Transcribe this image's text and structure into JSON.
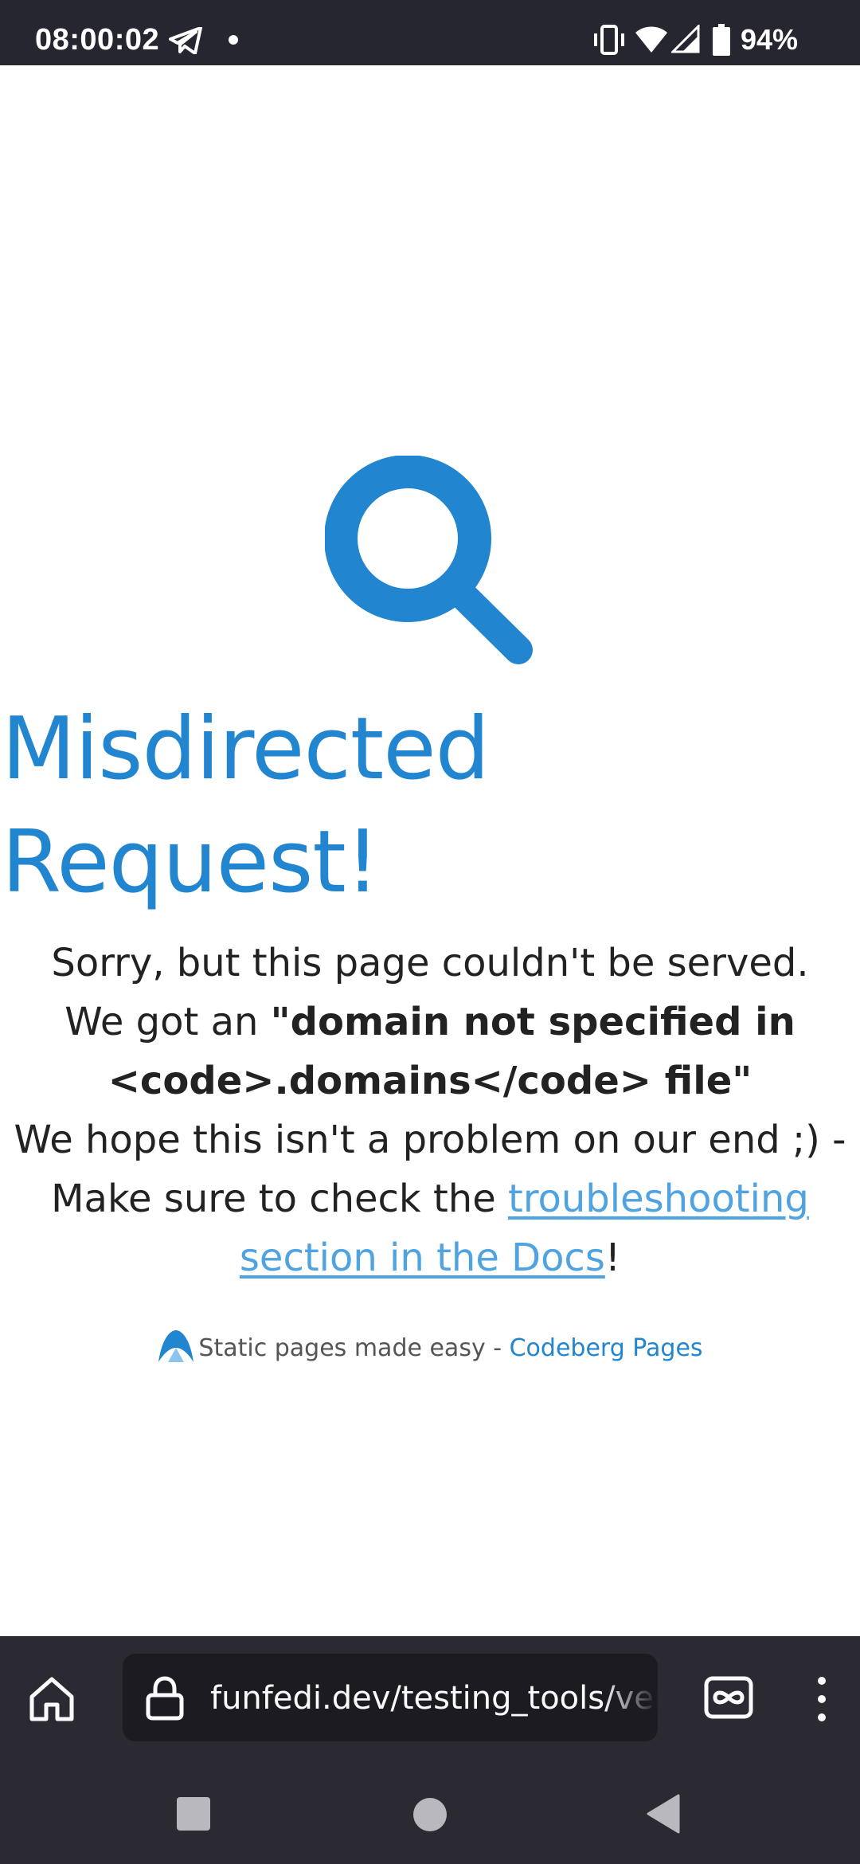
{
  "status_bar": {
    "time": "08:00:02",
    "battery": "94%",
    "icons": [
      "telegram-icon",
      "notification-dot",
      "vibrate-icon",
      "wifi-icon",
      "signal-icon",
      "battery-icon"
    ]
  },
  "page": {
    "icon": "magnifier-icon",
    "heading": "Misdirected Request!",
    "message": {
      "line1": "Sorry, but this page couldn't be served.",
      "line2_prefix": "We got an ",
      "error": "\"domain not specified in <code>.domains</code> file\"",
      "line3": "We hope this isn't a problem on our end ;) -",
      "line4_prefix": "Make sure to check the ",
      "link": "troubleshooting section in the Docs",
      "line4_suffix": "!"
    },
    "footer": {
      "text": "Static pages made easy - ",
      "link": "Codeberg Pages",
      "logo": "codeberg-logo"
    }
  },
  "browser_toolbar": {
    "url": "funfedi.dev/testing_tools/verify",
    "icons": [
      "home-icon",
      "lock-icon",
      "private-browsing-icon",
      "more-menu-icon"
    ]
  },
  "nav_bar": {
    "icons": [
      "recents-icon",
      "home-circle-icon",
      "back-icon"
    ]
  },
  "colors": {
    "accent": "#2185d0",
    "link": "#4fa3e0",
    "status_bar_bg": "#262630",
    "toolbar_bg": "#2b2a33",
    "url_bar_bg": "#1c1b22"
  }
}
